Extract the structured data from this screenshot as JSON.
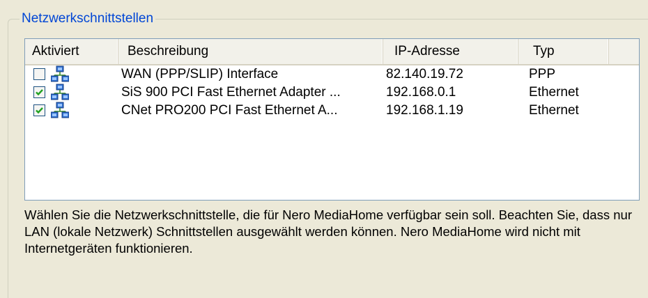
{
  "group": {
    "title": "Netzwerkschnittstellen"
  },
  "columns": [
    "Aktiviert",
    "Beschreibung",
    "IP-Adresse",
    "Typ"
  ],
  "rows": [
    {
      "checked": false,
      "icon": "network-icon",
      "description": "WAN (PPP/SLIP) Interface",
      "ip": "82.140.19.72",
      "type": "PPP"
    },
    {
      "checked": true,
      "icon": "network-icon",
      "description": "SiS 900 PCI Fast Ethernet Adapter ...",
      "ip": "192.168.0.1",
      "type": "Ethernet"
    },
    {
      "checked": true,
      "icon": "network-icon",
      "description": "CNet PRO200 PCI Fast Ethernet A...",
      "ip": "192.168.1.19",
      "type": "Ethernet"
    }
  ],
  "info": "Wählen Sie die Netzwerkschnittstelle, die für Nero MediaHome verfügbar sein soll. Beachten Sie, dass nur LAN (lokale Netzwerk) Schnittstellen ausgewählt werden können. Nero MediaHome wird nicht mit Internetgeräten funktionieren.",
  "colors": {
    "legend": "#0046d5",
    "checkmark": "#21a121",
    "background": "#ece9d8"
  }
}
